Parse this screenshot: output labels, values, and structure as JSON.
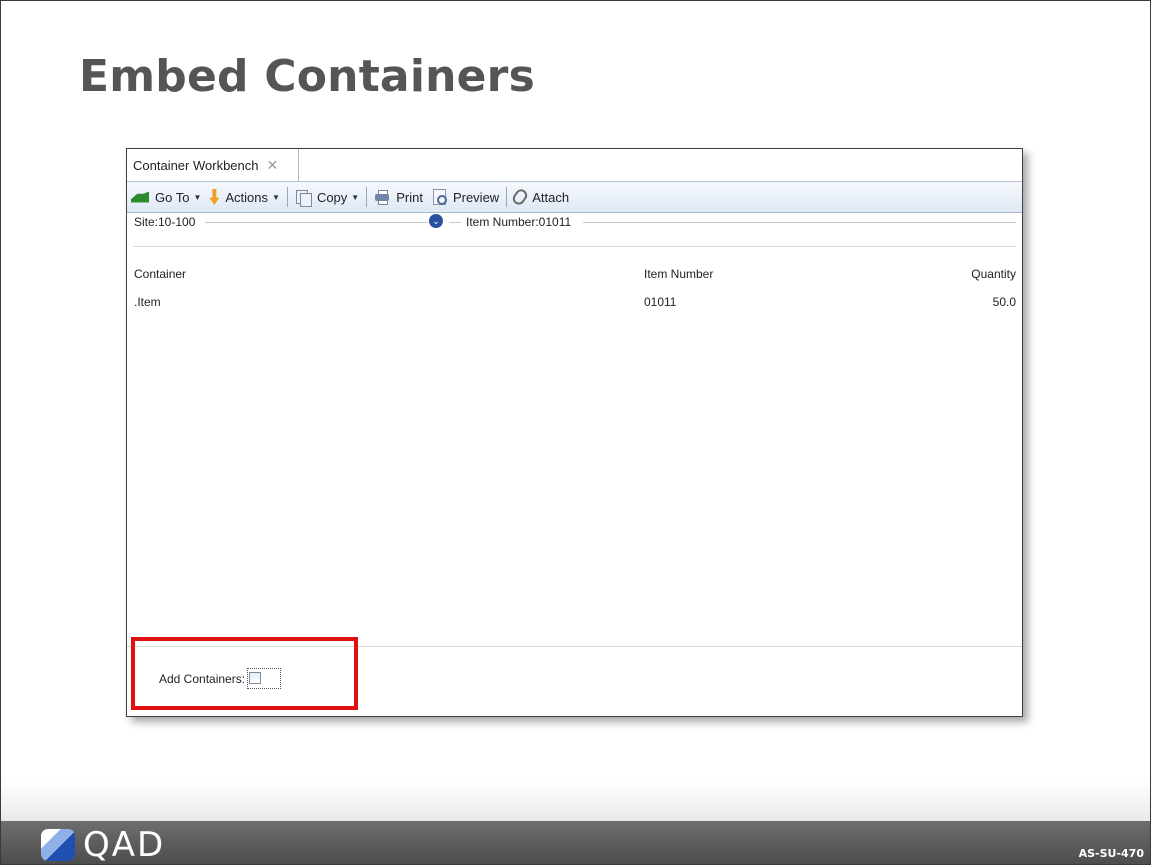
{
  "slide": {
    "title": "Embed Containers",
    "footer_code": "AS-SU-470"
  },
  "window": {
    "tab_label": "Container Workbench",
    "tab_close": "✕"
  },
  "toolbar": {
    "goto_label": "Go To",
    "actions_label": "Actions",
    "copy_label": "Copy",
    "print_label": "Print",
    "preview_label": "Preview",
    "attach_label": "Attach",
    "caret": "▼"
  },
  "filter": {
    "site_label": "Site:10-100",
    "expand_glyph": "⌄",
    "item_label": "Item Number:01011"
  },
  "grid": {
    "columns": [
      "Container",
      "Item Number",
      "Quantity"
    ],
    "rows": [
      {
        "container": ".Item",
        "item_number": "01011",
        "quantity": "50.0"
      }
    ]
  },
  "form": {
    "add_containers_label": "Add Containers:",
    "add_containers_checked": false
  },
  "brand": {
    "logo_text": "QAD"
  },
  "colors": {
    "highlight": "#e01010",
    "footer": "#5a5a5a",
    "toolbar": "#dfe8f5"
  }
}
